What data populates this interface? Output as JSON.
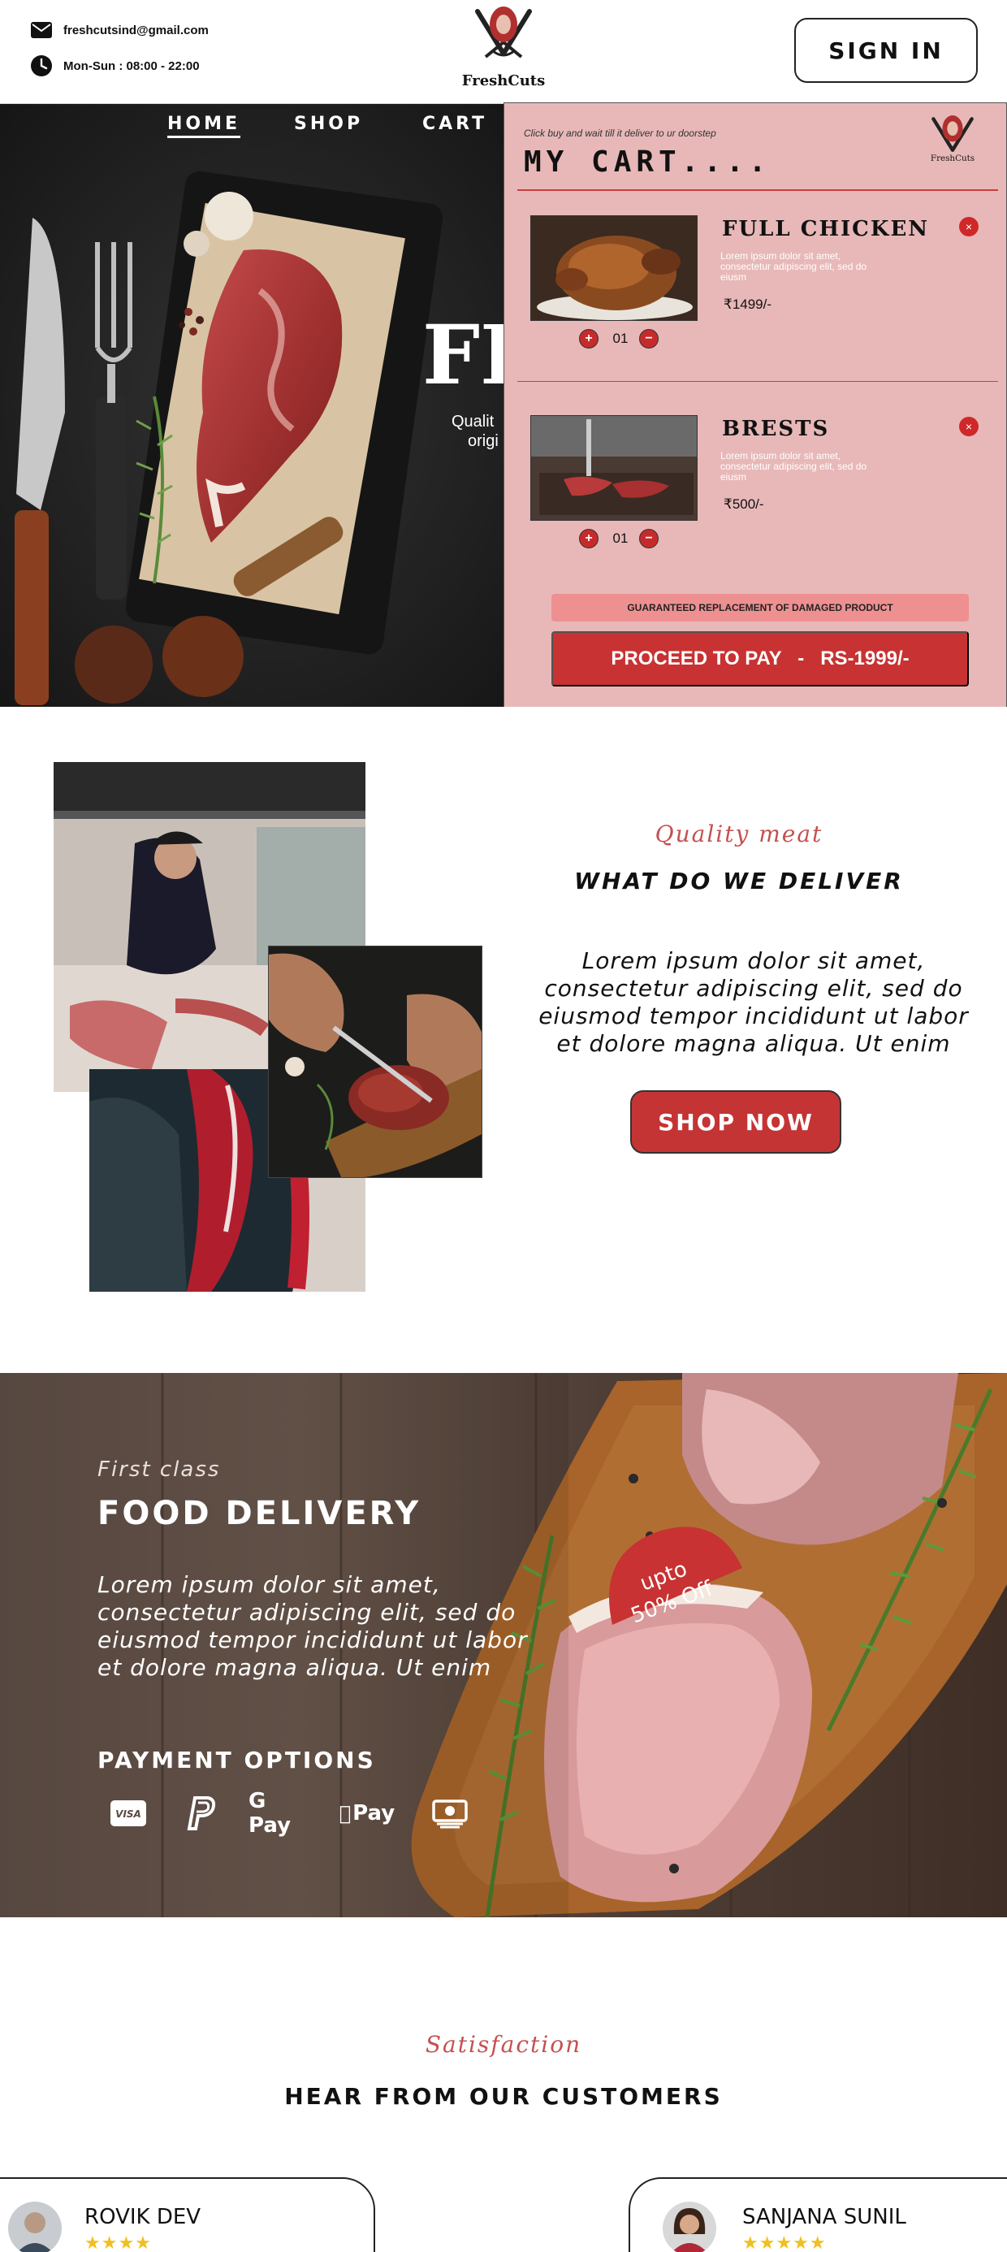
{
  "header": {
    "email": "freshcutsind@gmail.com",
    "hours": "Mon-Sun : 08:00 - 22:00",
    "brand": "FreshCuts",
    "signin_label": "SIGN IN"
  },
  "nav": {
    "items": [
      "HOME",
      "SHOP",
      "CART"
    ]
  },
  "hero": {
    "big_text": "FR",
    "sub_line1": "Qualit",
    "sub_line2": "origi"
  },
  "cart": {
    "note": "Click buy and wait till it deliver to ur doorstep",
    "title": "MY CART....",
    "items": [
      {
        "name": "FULL CHICKEN",
        "desc": "Lorem ipsum dolor sit amet, consectetur adipiscing elit, sed do eiusm",
        "price": "₹1499/-",
        "qty": "01",
        "plus": "+",
        "minus": "−",
        "remove": "×"
      },
      {
        "name": "BRESTS",
        "desc": "Lorem ipsum dolor sit amet, consectetur adipiscing elit, sed do eiusm",
        "price": "₹500/-",
        "qty": "01",
        "plus": "+",
        "minus": "−",
        "remove": "×"
      }
    ],
    "guarantee": "GUARANTEED REPLACEMENT OF DAMAGED PRODUCT",
    "proceed": "PROCEED TO PAY   -   RS-1999/-"
  },
  "quality": {
    "kicker": "Quality meat",
    "heading": "WHAT DO WE  DELIVER",
    "body": "Lorem ipsum dolor sit amet, consectetur adipiscing elit, sed do eiusmod tempor incididunt ut labor et dolore magna aliqua. Ut enim",
    "button": "SHOP NOW"
  },
  "delivery": {
    "kicker": "First class",
    "title": "FOOD DELIVERY",
    "body": "Lorem ipsum dolor sit amet, consectetur adipiscing elit, sed do eiusmod tempor incididunt ut labor et dolore magna aliqua. Ut enim",
    "payment_title": "PAYMENT OPTIONS",
    "payment_icons": [
      "visa-icon",
      "paypal-icon",
      "gpay-icon",
      "applepay-icon",
      "cash-icon"
    ],
    "gpay_text": "G Pay",
    "applepay_text": "Pay",
    "visa_text": "VISA",
    "badge_line1": "upto",
    "badge_line2": "50% Off"
  },
  "testimonials": {
    "kicker": "Satisfaction",
    "heading": "HEAR FROM OUR CUSTOMERS",
    "customers": [
      {
        "name": "ROVIK DEV",
        "stars": "★★★★",
        "rating": 4
      },
      {
        "name": "SANJANA SUNIL",
        "stars": "★★★★★",
        "rating": 5
      }
    ]
  },
  "colors": {
    "accent": "#c83232",
    "cart_bg": "#e8b8b8",
    "kicker": "#c55050"
  }
}
